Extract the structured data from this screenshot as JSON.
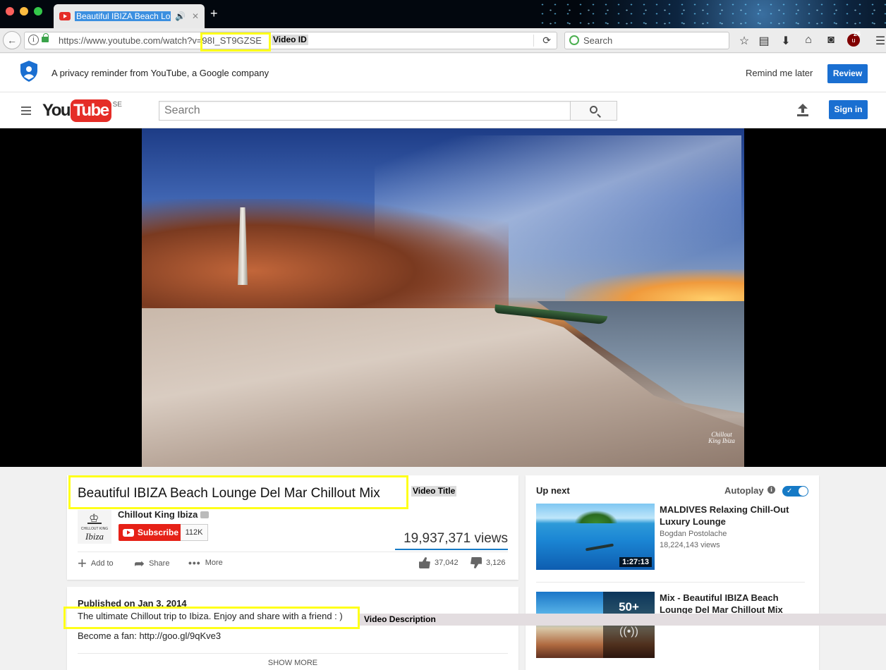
{
  "browser": {
    "tab_title": "Beautiful IBIZA Beach Lounge",
    "tab_sound_icon": "speaker-icon",
    "new_tab_symbol": "+",
    "close_symbol": "✕",
    "url_prefix": "https://www.youtube.com/watch?v=",
    "url_video_id": "98I_ST9GZSE",
    "search_placeholder": "Search",
    "addon_badge": "26"
  },
  "annotations": {
    "video_id": "Video ID",
    "video_title": "Video Title",
    "video_description": "Video Description",
    "highlight_color": "#ffff1a"
  },
  "privacy": {
    "message": "A privacy reminder from YouTube, a Google company",
    "remind_later": "Remind me later",
    "review": "Review"
  },
  "youtube_header": {
    "logo_you": "You",
    "logo_tube": "Tube",
    "country_code": "SE",
    "search_placeholder": "Search",
    "sign_in": "Sign in"
  },
  "player": {
    "watermark": "Chillout King Ibiza"
  },
  "video": {
    "title": "Beautiful IBIZA Beach Lounge Del Mar Chillout Mix",
    "channel": "Chillout King Ibiza",
    "avatar_small_text": "CHILLOUT KING",
    "avatar_script_text": "Ibiza",
    "subscribe": "Subscribe",
    "subscriber_count": "112K",
    "views": "19,937,371 views",
    "add_to": "Add to",
    "share": "Share",
    "more": "More",
    "likes": "37,042",
    "dislikes": "3,126"
  },
  "description": {
    "published": "Published on Jan 3, 2014",
    "text": "The ultimate Chillout trip to Ibiza. Enjoy and share with a friend : )",
    "fan_line": "Become a fan: http://goo.gl/9qKve3",
    "show_more": "SHOW MORE"
  },
  "sidebar": {
    "up_next": "Up next",
    "autoplay": "Autoplay",
    "autoplay_on": true,
    "items": [
      {
        "title": "MALDIVES Relaxing Chill-Out Luxury Lounge",
        "channel": "Bogdan Postolache",
        "views": "18,224,143 views",
        "duration": "1:27:13"
      },
      {
        "title": "Mix - Beautiful IBIZA Beach Lounge Del Mar Chillout Mix",
        "playlist_count": "50+"
      }
    ]
  },
  "colors": {
    "youtube_red": "#e52d27",
    "button_blue": "#1a6fd1",
    "page_background": "#f1f1f1"
  }
}
